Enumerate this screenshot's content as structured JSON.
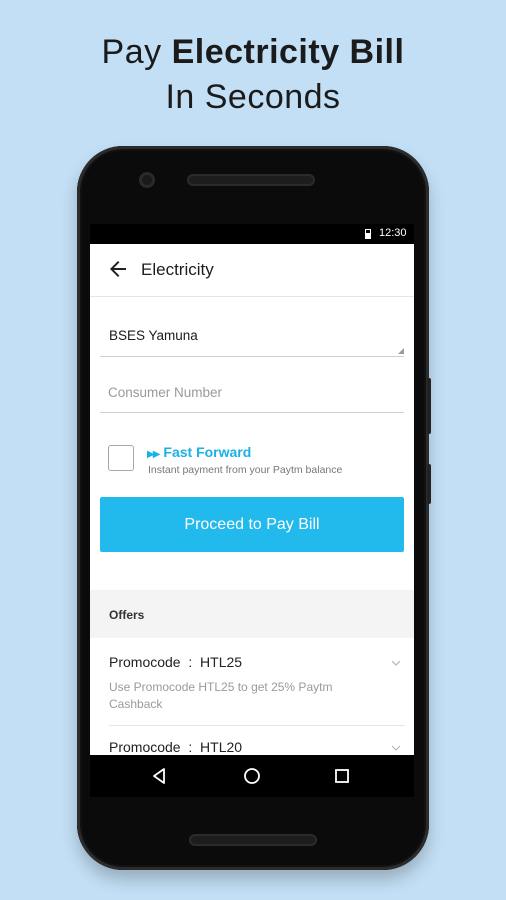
{
  "headline": {
    "line1_prefix": "Pay ",
    "line1_bold": "Electricity Bill",
    "line2": "In Seconds"
  },
  "status_bar": {
    "time": "12:30"
  },
  "toolbar": {
    "title": "Electricity",
    "back_icon": "back-arrow-icon"
  },
  "form": {
    "operator_value": "BSES Yamuna",
    "consumer_number_placeholder": "Consumer Number"
  },
  "fast_forward": {
    "title": "Fast Forward",
    "subtitle": "Instant payment from your Paytm balance",
    "icon": "fast-forward-icon",
    "checked": false
  },
  "proceed_button": {
    "label": "Proceed to Pay Bill"
  },
  "offers": {
    "label": "Offers",
    "items": [
      {
        "title": "Promocode  :  HTL25",
        "description": "Use Promocode HTL25 to get 25% Paytm Cashback"
      },
      {
        "title": "Promocode  :  HTL20",
        "description": ""
      }
    ]
  },
  "nav": {
    "back": "nav-back-icon",
    "home": "nav-home-icon",
    "recents": "nav-recents-icon"
  },
  "colors": {
    "background": "#c3dff5",
    "accent": "#22baec",
    "link": "#1ab0e8"
  }
}
